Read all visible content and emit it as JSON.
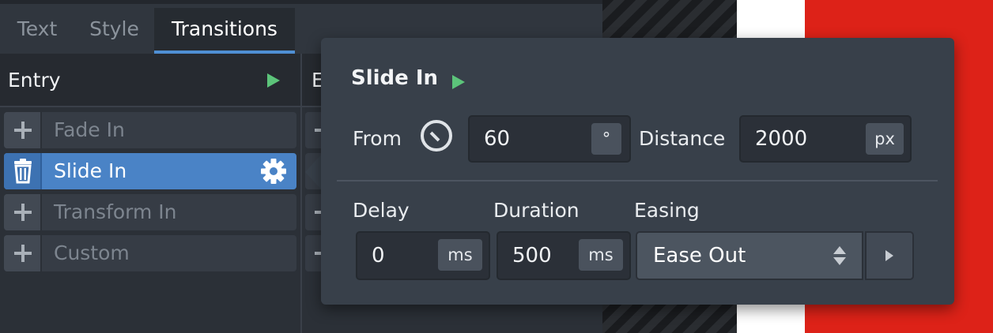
{
  "tabs": [
    {
      "label": "Text"
    },
    {
      "label": "Style"
    },
    {
      "label": "Transitions",
      "active": true
    }
  ],
  "entry": {
    "title": "Entry",
    "items": [
      {
        "label": "Fade In",
        "icon": "plus-icon"
      },
      {
        "label": "Slide In",
        "icon": "trash-icon",
        "active": true,
        "action_icon": "gear-icon"
      },
      {
        "label": "Transform In",
        "icon": "plus-icon"
      },
      {
        "label": "Custom",
        "icon": "plus-icon"
      }
    ]
  },
  "exit": {
    "title": "E"
  },
  "popover": {
    "title": "Slide In",
    "from_label": "From",
    "from_icon": "angle-gauge-icon",
    "from_value": "60",
    "from_unit": "°",
    "distance_label": "Distance",
    "distance_value": "2000",
    "distance_unit": "px",
    "delay_label": "Delay",
    "delay_value": "0",
    "delay_unit": "ms",
    "duration_label": "Duration",
    "duration_value": "500",
    "duration_unit": "ms",
    "easing_label": "Easing",
    "easing_value": "Ease Out"
  },
  "colors": {
    "accent": "#4a83c6",
    "play": "#5cc47a",
    "preview_red": "#dd2218"
  }
}
